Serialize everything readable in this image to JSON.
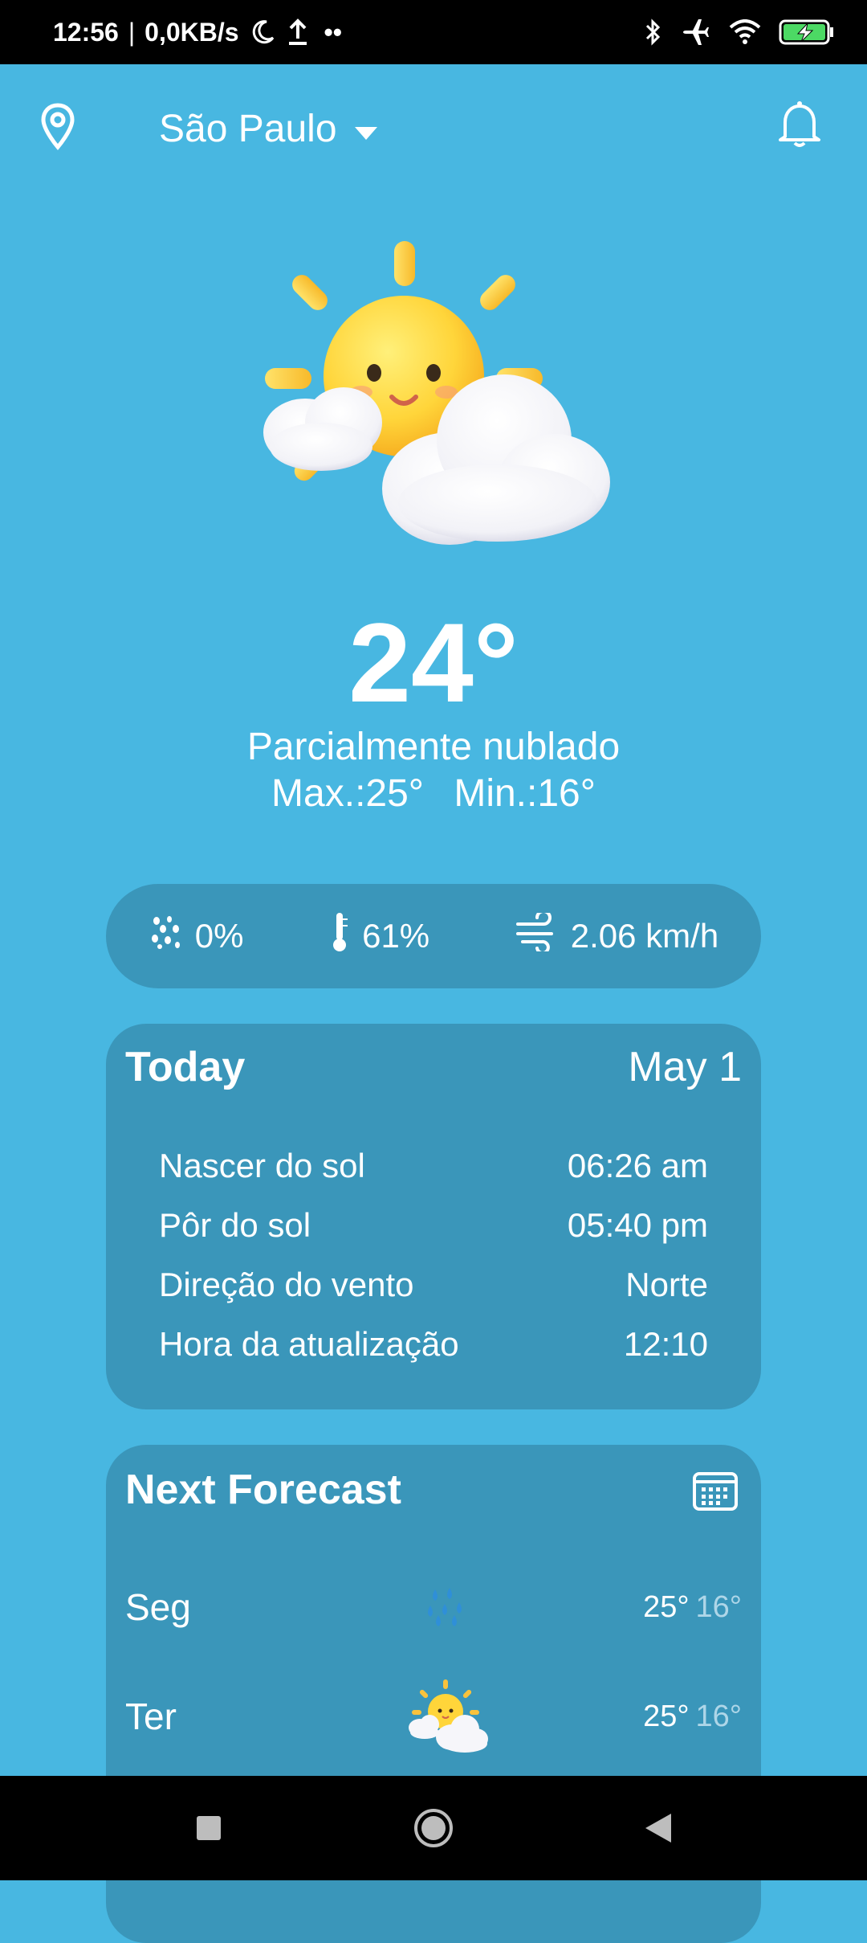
{
  "status_bar": {
    "time": "12:56",
    "separator": "|",
    "speed": "0,0KB/s",
    "dots": "••",
    "icons": [
      "moon-icon",
      "upload-icon",
      "bluetooth-icon",
      "airplane-icon",
      "wifi-icon",
      "battery-charging-icon"
    ]
  },
  "header": {
    "city": "São Paulo",
    "icons": [
      "location-pin-icon",
      "dropdown-arrow-icon",
      "bell-icon"
    ]
  },
  "current": {
    "icon": "sun-with-clouds-icon",
    "temperature": "24°",
    "condition": "Parcialmente nublado",
    "max": "Max.:25°",
    "min": "Min.:16°"
  },
  "stats": {
    "precipitation": "0%",
    "humidity": "61%",
    "wind": "2.06 km/h"
  },
  "today": {
    "title": "Today",
    "date": "May 1",
    "rows": [
      {
        "label": "Nascer do sol",
        "value": "06:26 am"
      },
      {
        "label": "Pôr do sol",
        "value": "05:40 pm"
      },
      {
        "label": "Direção do vento",
        "value": "Norte"
      },
      {
        "label": "Hora da atualização",
        "value": "12:10"
      }
    ]
  },
  "forecast": {
    "title": "Next Forecast",
    "days": [
      {
        "day": "Seg",
        "icon": "rain-drops-icon",
        "max": "25°",
        "min": "16°"
      },
      {
        "day": "Ter",
        "icon": "sun-with-clouds-icon",
        "max": "25°",
        "min": "16°"
      }
    ]
  },
  "colors": {
    "background": "#48B7E1",
    "card": "#3A96BA",
    "text": "#FFFFFF",
    "muted": "#AED6E8"
  }
}
